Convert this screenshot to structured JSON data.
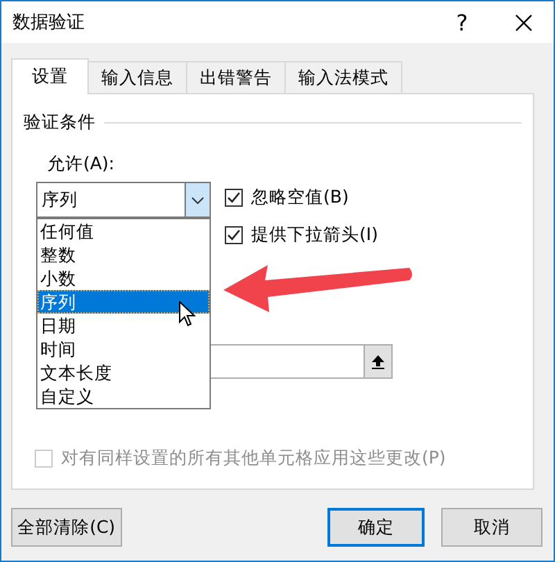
{
  "window": {
    "title": "数据验证",
    "help": "?"
  },
  "tabs": [
    {
      "label": "设置",
      "selected": true
    },
    {
      "label": "输入信息",
      "selected": false
    },
    {
      "label": "出错警告",
      "selected": false
    },
    {
      "label": "输入法模式",
      "selected": false
    }
  ],
  "section": {
    "title": "验证条件"
  },
  "allow": {
    "label": "允许(A):",
    "value": "序列",
    "options": [
      {
        "label": "任何值",
        "selected": false
      },
      {
        "label": "整数",
        "selected": false
      },
      {
        "label": "小数",
        "selected": false
      },
      {
        "label": "序列",
        "selected": true
      },
      {
        "label": "日期",
        "selected": false
      },
      {
        "label": "时间",
        "selected": false
      },
      {
        "label": "文本长度",
        "selected": false
      },
      {
        "label": "自定义",
        "selected": false
      }
    ]
  },
  "checkboxes": [
    {
      "label": "忽略空值(B)",
      "checked": true
    },
    {
      "label": "提供下拉箭头(I)",
      "checked": true
    }
  ],
  "apply_all": {
    "label": "对有同样设置的所有其他单元格应用这些更改(P)",
    "checked": false,
    "disabled": true
  },
  "buttons": [
    {
      "label": "全部清除(C)",
      "default": false
    },
    {
      "label": "确定",
      "default": true
    },
    {
      "label": "取消",
      "default": false
    }
  ]
}
